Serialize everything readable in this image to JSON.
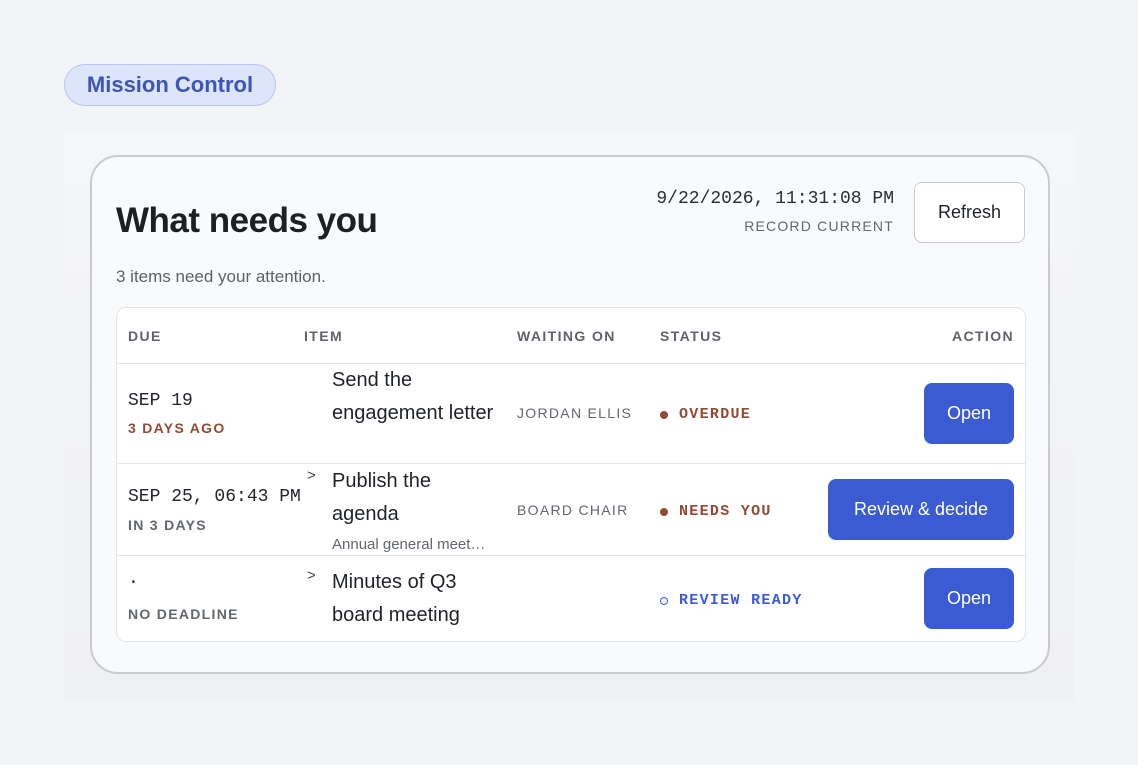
{
  "badge": "Mission Control",
  "header": {
    "title": "What needs you",
    "subtitle": "3 items need your attention.",
    "timestamp": "9/22/2026, 11:31:08 PM",
    "record_status": "RECORD CURRENT",
    "refresh_label": "Refresh"
  },
  "table": {
    "columns": [
      "DUE",
      "ITEM",
      "WAITING ON",
      "STATUS",
      "ACTION"
    ],
    "rows": [
      {
        "due": "SEP 19",
        "relative": "3 DAYS AGO",
        "item": "Send the engagement letter",
        "item_sub": "",
        "waiting_on": "JORDAN ELLIS",
        "status": "OVERDUE",
        "action": "Open"
      },
      {
        "due": "SEP 25, 06:43 PM",
        "relative": "IN 3 DAYS",
        "item": "Publish the agenda",
        "item_sub": "Annual general meet…",
        "waiting_on": "BOARD CHAIR",
        "status": "NEEDS YOU",
        "action": "Review & decide"
      },
      {
        "due": "·",
        "relative": "NO DEADLINE",
        "item": "Minutes of Q3 board meeting",
        "item_sub": "",
        "waiting_on": "",
        "status": "REVIEW READY",
        "action": "Open"
      }
    ]
  },
  "icons": {
    "expand": "chevron-right-icon",
    "status_filled": "dot-icon",
    "status_open": "ring-icon"
  },
  "colors": {
    "accent": "#3b5bd2",
    "overdue": "#934a35",
    "review": "#3b5bdb",
    "badge_bg": "#dde5fb"
  }
}
